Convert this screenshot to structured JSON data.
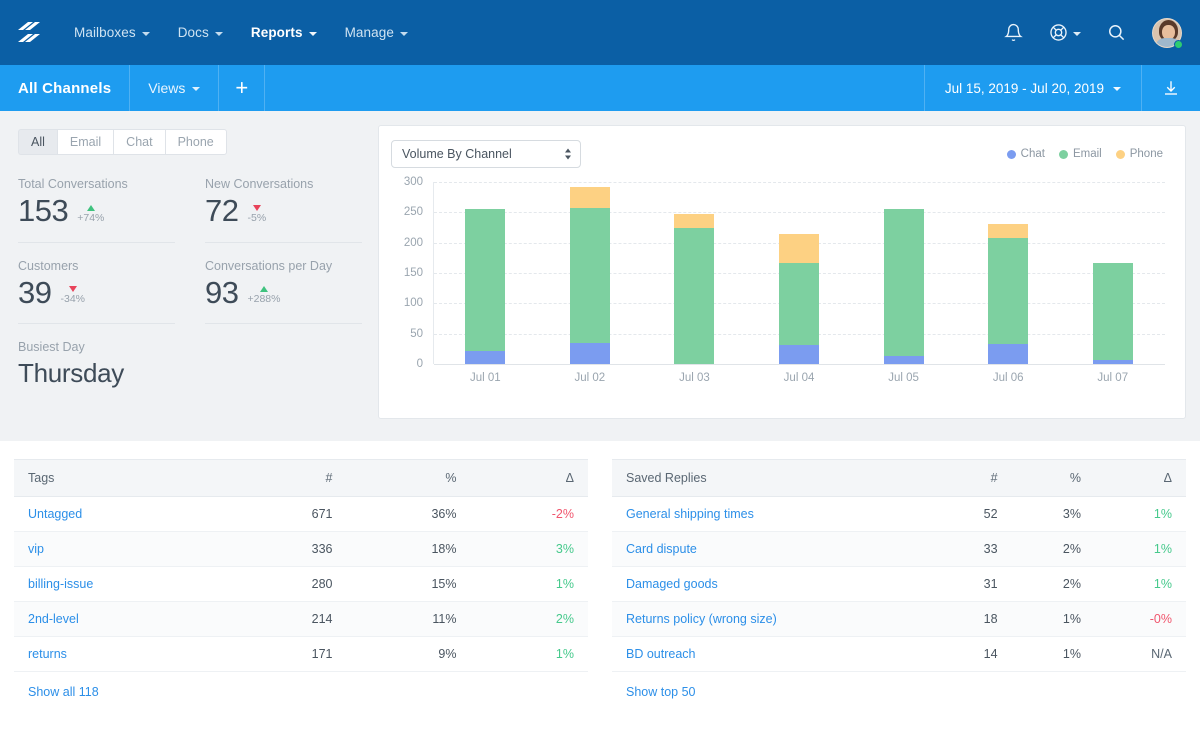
{
  "topnav": {
    "logo_icon": "helpscout-logo-icon",
    "items": [
      {
        "label": "Mailboxes",
        "caret": true,
        "active": false
      },
      {
        "label": "Docs",
        "caret": true,
        "active": false
      },
      {
        "label": "Reports",
        "caret": true,
        "active": true
      },
      {
        "label": "Manage",
        "caret": true,
        "active": false
      }
    ],
    "icons": [
      "bell-icon",
      "lifesaver-icon",
      "search-icon",
      "avatar"
    ]
  },
  "subnav": {
    "channel_label": "All Channels",
    "views_label": "Views",
    "add_label": "+",
    "date_range": "Jul 15, 2019 - Jul 20, 2019",
    "download_icon": "download-icon"
  },
  "stats": {
    "channel_tabs": [
      {
        "label": "All",
        "active": true
      },
      {
        "label": "Email",
        "active": false
      },
      {
        "label": "Chat",
        "active": false
      },
      {
        "label": "Phone",
        "active": false
      }
    ],
    "cells": [
      {
        "label": "Total Conversations",
        "value": "153",
        "delta": "+74%",
        "dir": "up"
      },
      {
        "label": "New Conversations",
        "value": "72",
        "delta": "-5%",
        "dir": "down"
      },
      {
        "label": "Customers",
        "value": "39",
        "delta": "-34%",
        "dir": "down"
      },
      {
        "label": "Conversations per Day",
        "value": "93",
        "delta": "+288%",
        "dir": "up"
      }
    ],
    "busiest": {
      "label": "Busiest Day",
      "value": "Thursday"
    }
  },
  "chart_card": {
    "select_value": "Volume By Channel",
    "select_options": [
      "Volume By Channel"
    ]
  },
  "chart_data": {
    "type": "bar",
    "stacked": true,
    "title": "Volume By Channel",
    "xlabel": "",
    "ylabel": "",
    "ylim": [
      0,
      300
    ],
    "yticks": [
      0,
      50,
      100,
      150,
      200,
      250,
      300
    ],
    "grid": true,
    "legend_position": "top-right",
    "categories": [
      "Jul 01",
      "Jul 02",
      "Jul 03",
      "Jul 04",
      "Jul 05",
      "Jul 06",
      "Jul 07"
    ],
    "series": [
      {
        "name": "Chat",
        "color": "#7B9CF0",
        "values": [
          22,
          35,
          0,
          32,
          14,
          33,
          6
        ]
      },
      {
        "name": "Email",
        "color": "#7DD0A0",
        "values": [
          234,
          222,
          224,
          135,
          242,
          174,
          161
        ]
      },
      {
        "name": "Phone",
        "color": "#FDD183",
        "values": [
          0,
          35,
          24,
          48,
          0,
          23,
          0
        ]
      }
    ],
    "totals": [
      256,
      292,
      248,
      215,
      256,
      230,
      167
    ]
  },
  "tables": [
    {
      "name": "tags-table",
      "columns": [
        "Tags",
        "#",
        "%",
        "Δ"
      ],
      "rows": [
        {
          "name": "Untagged",
          "count": "671",
          "pct": "36%",
          "delta": "-2%",
          "delta_sign": "neg"
        },
        {
          "name": "vip",
          "count": "336",
          "pct": "18%",
          "delta": "3%",
          "delta_sign": "pos"
        },
        {
          "name": "billing-issue",
          "count": "280",
          "pct": "15%",
          "delta": "1%",
          "delta_sign": "pos"
        },
        {
          "name": "2nd-level",
          "count": "214",
          "pct": "11%",
          "delta": "2%",
          "delta_sign": "pos"
        },
        {
          "name": "returns",
          "count": "171",
          "pct": "9%",
          "delta": "1%",
          "delta_sign": "pos"
        }
      ],
      "footer_link": "Show all 118"
    },
    {
      "name": "saved-replies-table",
      "columns": [
        "Saved Replies",
        "#",
        "%",
        "Δ"
      ],
      "rows": [
        {
          "name": "General shipping times",
          "count": "52",
          "pct": "3%",
          "delta": "1%",
          "delta_sign": "pos"
        },
        {
          "name": "Card dispute",
          "count": "33",
          "pct": "2%",
          "delta": "1%",
          "delta_sign": "pos"
        },
        {
          "name": "Damaged goods",
          "count": "31",
          "pct": "2%",
          "delta": "1%",
          "delta_sign": "pos"
        },
        {
          "name": "Returns policy (wrong size)",
          "count": "18",
          "pct": "1%",
          "delta": "-0%",
          "delta_sign": "neg"
        },
        {
          "name": "BD outreach",
          "count": "14",
          "pct": "1%",
          "delta": "N/A",
          "delta_sign": "na"
        }
      ],
      "footer_link": "Show top 50"
    }
  ],
  "colors": {
    "nav_dark": "#0B5FA5",
    "nav_light": "#1E9CF0",
    "link": "#2C8FE8",
    "positive": "#46C98C",
    "negative": "#F0566E",
    "page_bg": "#F0F2F4"
  }
}
